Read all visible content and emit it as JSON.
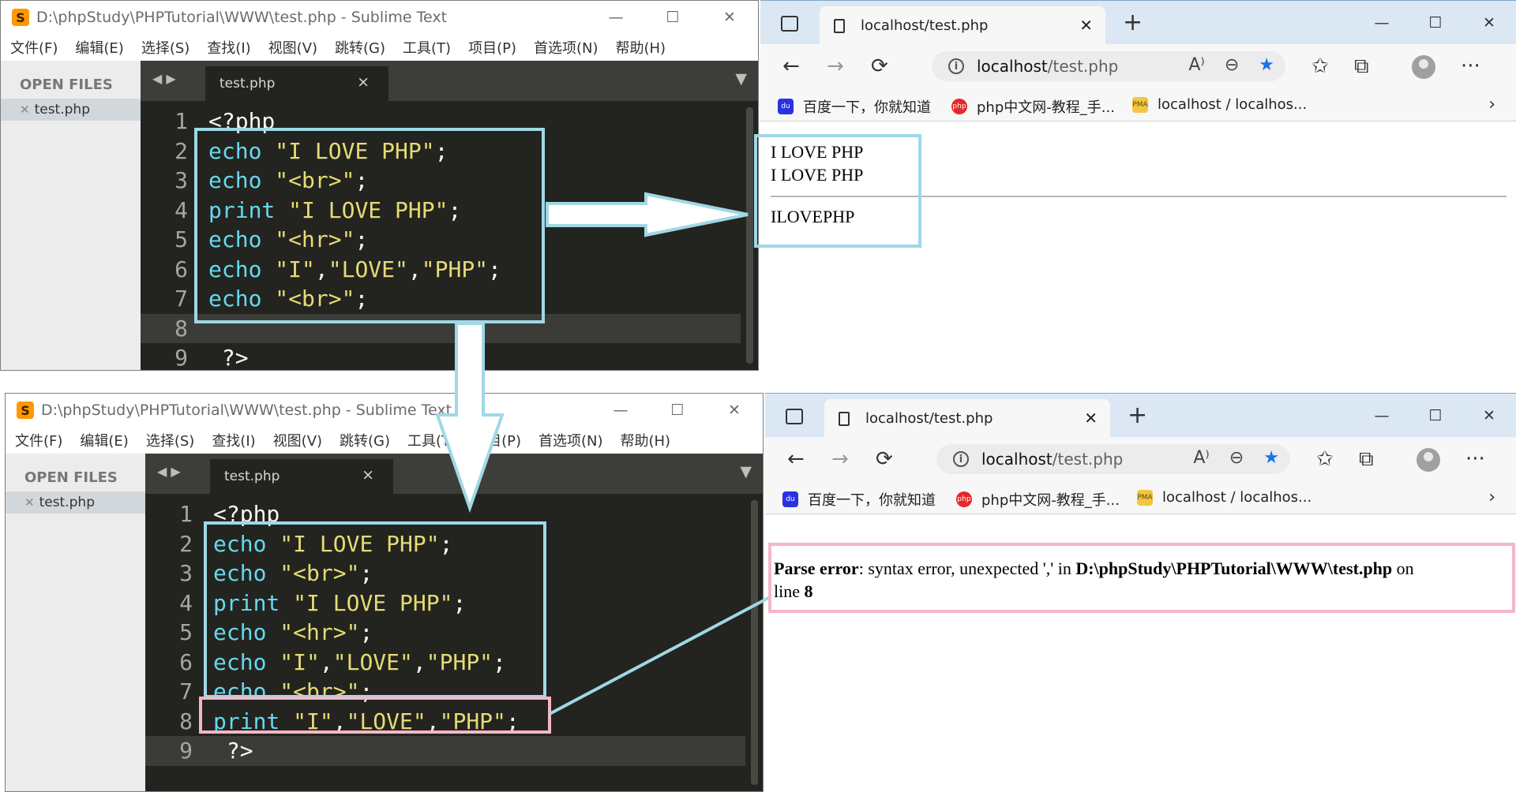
{
  "editor": {
    "title": "D:\\phpStudy\\PHPTutorial\\WWW\\test.php - Sublime Text",
    "logo_letter": "S",
    "menu": [
      "文件(F)",
      "编辑(E)",
      "选择(S)",
      "查找(I)",
      "视图(V)",
      "跳转(G)",
      "工具(T)",
      "项目(P)",
      "首选项(N)",
      "帮助(H)"
    ],
    "sidebar_header": "OPEN FILES",
    "open_file": "test.php",
    "tab_label": "test.php",
    "window_buttons": [
      "—",
      "☐",
      "✕"
    ]
  },
  "top_editor": {
    "lines": [
      {
        "num": "1",
        "tokens": [
          {
            "t": "<?php",
            "c": "plain"
          }
        ]
      },
      {
        "num": "2",
        "tokens": [
          {
            "t": "echo",
            "c": "kw"
          },
          {
            "t": " \"I LOVE PHP\"",
            "c": "str"
          },
          {
            "t": ";",
            "c": "plain"
          }
        ]
      },
      {
        "num": "3",
        "tokens": [
          {
            "t": "echo",
            "c": "kw"
          },
          {
            "t": " \"<br>\"",
            "c": "str"
          },
          {
            "t": ";",
            "c": "plain"
          }
        ]
      },
      {
        "num": "4",
        "tokens": [
          {
            "t": "print",
            "c": "kw"
          },
          {
            "t": " \"I LOVE PHP\"",
            "c": "str"
          },
          {
            "t": ";",
            "c": "plain"
          }
        ]
      },
      {
        "num": "5",
        "tokens": [
          {
            "t": "echo",
            "c": "kw"
          },
          {
            "t": " \"<hr>\"",
            "c": "str"
          },
          {
            "t": ";",
            "c": "plain"
          }
        ]
      },
      {
        "num": "6",
        "tokens": [
          {
            "t": "echo",
            "c": "kw"
          },
          {
            "t": " \"I\"",
            "c": "str"
          },
          {
            "t": ",",
            "c": "plain"
          },
          {
            "t": "\"LOVE\"",
            "c": "str"
          },
          {
            "t": ",",
            "c": "plain"
          },
          {
            "t": "\"PHP\"",
            "c": "str"
          },
          {
            "t": ";",
            "c": "plain"
          }
        ]
      },
      {
        "num": "7",
        "tokens": [
          {
            "t": "echo",
            "c": "kw"
          },
          {
            "t": " \"<br>\"",
            "c": "str"
          },
          {
            "t": ";",
            "c": "plain"
          }
        ]
      },
      {
        "num": "8",
        "tokens": []
      },
      {
        "num": "9",
        "tokens": [
          {
            "t": " ?>",
            "c": "plain"
          }
        ]
      }
    ],
    "current_line": 8
  },
  "bottom_editor": {
    "lines": [
      {
        "num": "1",
        "tokens": [
          {
            "t": "<?php",
            "c": "plain"
          }
        ]
      },
      {
        "num": "2",
        "tokens": [
          {
            "t": "echo",
            "c": "kw"
          },
          {
            "t": " \"I LOVE PHP\"",
            "c": "str"
          },
          {
            "t": ";",
            "c": "plain"
          }
        ]
      },
      {
        "num": "3",
        "tokens": [
          {
            "t": "echo",
            "c": "kw"
          },
          {
            "t": " \"<br>\"",
            "c": "str"
          },
          {
            "t": ";",
            "c": "plain"
          }
        ]
      },
      {
        "num": "4",
        "tokens": [
          {
            "t": "print",
            "c": "kw"
          },
          {
            "t": " \"I LOVE PHP\"",
            "c": "str"
          },
          {
            "t": ";",
            "c": "plain"
          }
        ]
      },
      {
        "num": "5",
        "tokens": [
          {
            "t": "echo",
            "c": "kw"
          },
          {
            "t": " \"<hr>\"",
            "c": "str"
          },
          {
            "t": ";",
            "c": "plain"
          }
        ]
      },
      {
        "num": "6",
        "tokens": [
          {
            "t": "echo",
            "c": "kw"
          },
          {
            "t": " \"I\"",
            "c": "str"
          },
          {
            "t": ",",
            "c": "plain"
          },
          {
            "t": "\"LOVE\"",
            "c": "str"
          },
          {
            "t": ",",
            "c": "plain"
          },
          {
            "t": "\"PHP\"",
            "c": "str"
          },
          {
            "t": ";",
            "c": "plain"
          }
        ]
      },
      {
        "num": "7",
        "tokens": [
          {
            "t": "echo",
            "c": "kw"
          },
          {
            "t": " \"<br>\"",
            "c": "str"
          },
          {
            "t": ";",
            "c": "plain"
          }
        ]
      },
      {
        "num": "8",
        "tokens": [
          {
            "t": "print",
            "c": "kw"
          },
          {
            "t": " \"I\"",
            "c": "str"
          },
          {
            "t": ",",
            "c": "plain"
          },
          {
            "t": "\"LOVE\"",
            "c": "str"
          },
          {
            "t": ",",
            "c": "plain"
          },
          {
            "t": "\"PHP\"",
            "c": "str"
          },
          {
            "t": ";",
            "c": "plain"
          }
        ]
      },
      {
        "num": "9",
        "tokens": [
          {
            "t": " ?>",
            "c": "plain"
          }
        ]
      }
    ],
    "current_line": 9
  },
  "browser": {
    "tab_title": "localhost/test.php",
    "tab_close": "✕",
    "new_tab": "+",
    "url_host": "localhost",
    "url_path": "/test.php",
    "bookmarks": [
      {
        "label": "百度一下，你就知道",
        "icon": "baidu-icon",
        "glyph": "du"
      },
      {
        "label": "php中文网-教程_手...",
        "icon": "php-icon",
        "glyph": "php"
      },
      {
        "label": "localhost / localhos...",
        "icon": "phpmyadmin-icon",
        "glyph": "PMA"
      }
    ],
    "window_buttons": [
      "—",
      "☐",
      "✕"
    ],
    "toolbar_icons": {
      "back": "←",
      "forward": "→",
      "refresh": "⟳",
      "info": "i",
      "read_aloud": "A⁾",
      "zoom": "⊖",
      "favorite": "★",
      "favorites_hub": "✩",
      "collections": "⧉",
      "menu": "···",
      "bookmarks_more": "›"
    }
  },
  "top_output": {
    "lines": [
      "I LOVE PHP",
      "I LOVE PHP"
    ],
    "after_rule": "ILOVEPHP"
  },
  "bottom_output": {
    "error_label": "Parse error",
    "error_message": ": syntax error, unexpected ',' in ",
    "error_file": "D:\\phpStudy\\PHPTutorial\\WWW\\test.php",
    "error_on": " on",
    "error_line_label": "line ",
    "error_line_number": "8"
  },
  "annotation_colors": {
    "highlight": "#9fd8e6",
    "error": "#f4b6c8"
  }
}
